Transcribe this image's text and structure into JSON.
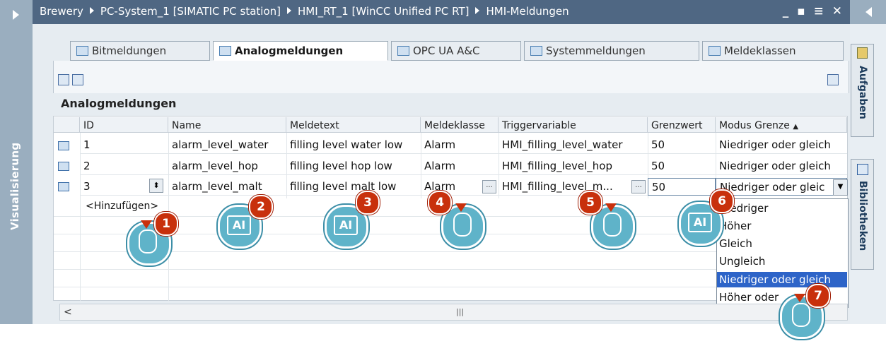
{
  "breadcrumb": [
    "Brewery",
    "PC-System_1 [SIMATIC PC station]",
    "HMI_RT_1 [WinCC Unified PC RT]",
    "HMI-Meldungen"
  ],
  "window_controls": "_ ▪ ≡ ✕",
  "left_rail_label": "Visualisierung",
  "right_tabs": [
    "Aufgaben",
    "Bibliotheken"
  ],
  "tabs": [
    {
      "label": "Bitmeldungen",
      "active": false
    },
    {
      "label": "Analogmeldungen",
      "active": true
    },
    {
      "label": "OPC UA A&C",
      "active": false
    },
    {
      "label": "Systemmeldungen",
      "active": false
    },
    {
      "label": "Meldeklassen",
      "active": false
    }
  ],
  "section_title": "Analogmeldungen",
  "columns": [
    "ID",
    "Name",
    "Meldetext",
    "Meldeklasse",
    "Triggervariable",
    "Grenzwert",
    "Modus Grenze"
  ],
  "sort_indicator": "▲",
  "rows": [
    {
      "id": "1",
      "name": "alarm_level_water",
      "text": "filling level water low",
      "class": "Alarm",
      "trigger": "HMI_filling_level_water",
      "limit": "50",
      "mode": "Niedriger oder gleich"
    },
    {
      "id": "2",
      "name": "alarm_level_hop",
      "text": "filling level hop low",
      "class": "Alarm",
      "trigger": "HMI_filling_level_hop",
      "limit": "50",
      "mode": "Niedriger oder gleich"
    },
    {
      "id": "3",
      "name": "alarm_level_malt",
      "text": "filling level malt low",
      "class": "Alarm",
      "trigger": "HMI_filling_level_m...",
      "limit": "50",
      "mode": "Niedriger oder gleic"
    }
  ],
  "add_row_label": "<Hinzufügen>",
  "ellipsis_label": "...",
  "dropdown_options": [
    "Niedriger",
    "Höher",
    "Gleich",
    "Ungleich",
    "Niedriger oder gleich",
    "Höher oder"
  ],
  "dropdown_selected_index": 4,
  "callouts": [
    "1",
    "2",
    "3",
    "4",
    "5",
    "6",
    "7"
  ],
  "ai_label": "AI",
  "scrollbar_center": "|||",
  "colors": {
    "titlebar": "#4f6783",
    "rail": "#9aaebf",
    "callout_badge": "#c8300c",
    "callout_bubble": "#5fb3c9",
    "selection": "#2d64c8"
  }
}
